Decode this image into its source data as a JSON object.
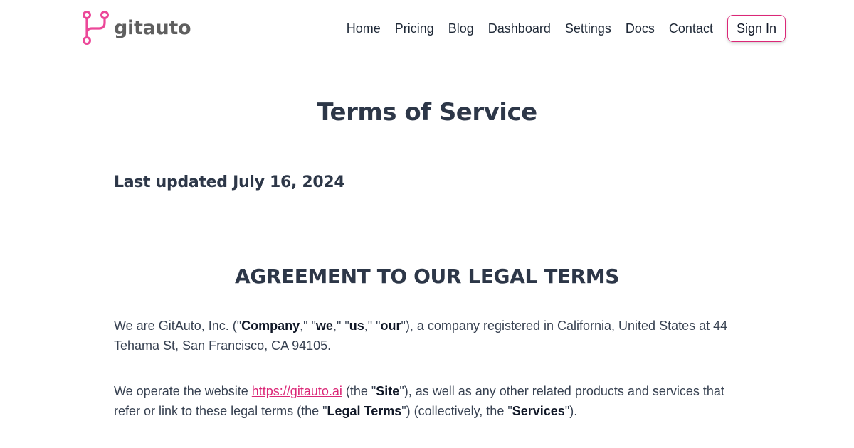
{
  "brand": {
    "name": "gitauto",
    "accent_color": "#db2777",
    "logo_icon": "git-branch-icon"
  },
  "nav": {
    "items": [
      "Home",
      "Pricing",
      "Blog",
      "Dashboard",
      "Settings",
      "Docs",
      "Contact"
    ],
    "sign_in": "Sign In"
  },
  "page": {
    "title": "Terms of Service",
    "last_updated": "Last updated July 16, 2024",
    "section_heading": "AGREEMENT TO OUR LEGAL TERMS"
  },
  "para1": {
    "t1": "We are GitAuto, Inc. (\"",
    "b1": "Company",
    "t2": ",\" \"",
    "b2": "we",
    "t3": ",\" \"",
    "b3": "us",
    "t4": ",\" \"",
    "b4": "our",
    "t5": "\"), a company registered in California, United States at 44 Tehama St, San Francisco, CA 94105."
  },
  "para2": {
    "t1": "We operate the website ",
    "link": "https://gitauto.ai",
    "t2": " (the \"",
    "b1": "Site",
    "t3": "\"), as well as any other related products and services that refer or link to these legal terms (the \"",
    "b2": "Legal Terms",
    "t4": "\") (collectively, the \"",
    "b3": "Services",
    "t5": "\")."
  }
}
